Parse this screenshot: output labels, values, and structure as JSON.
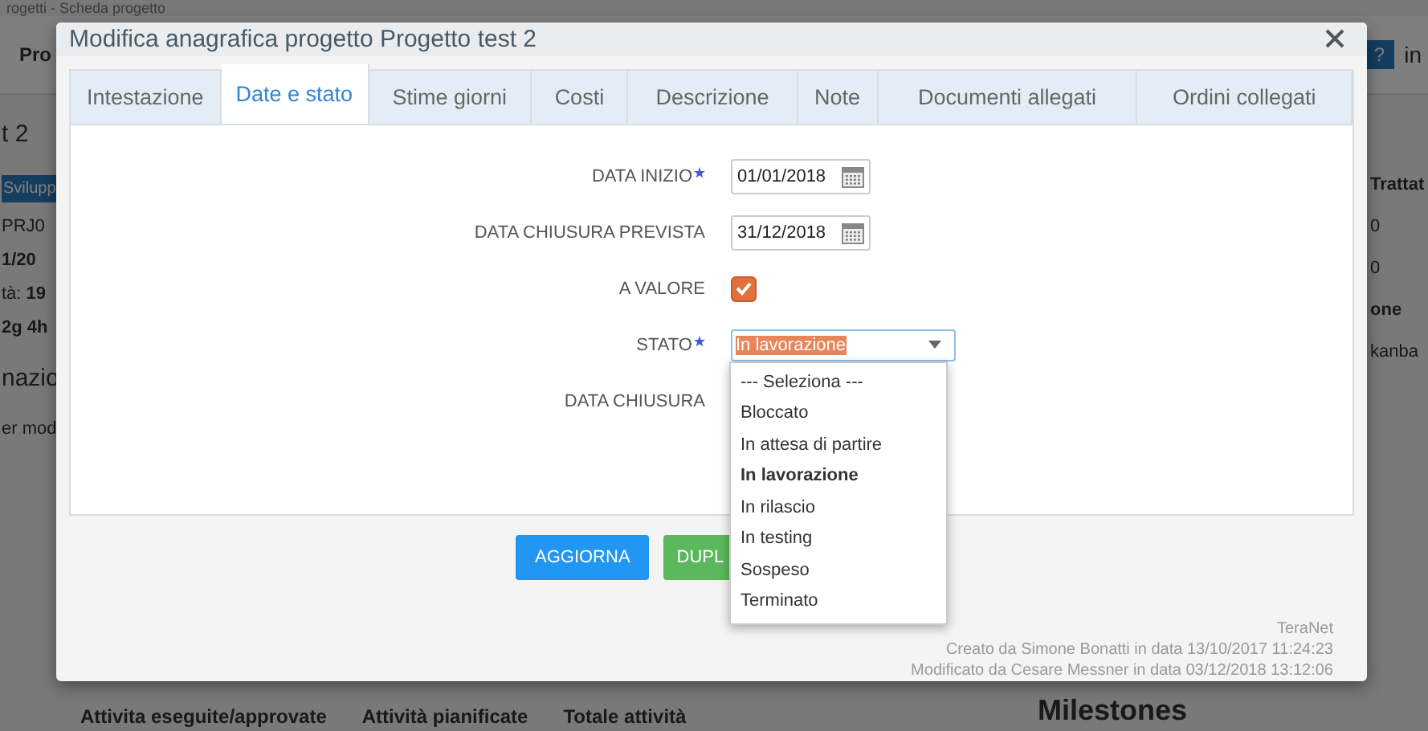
{
  "background": {
    "breadcrumb": "rogetti - Scheda progetto",
    "header_title": "Pro",
    "help": "?",
    "user": "in",
    "left": [
      {
        "kind": "title",
        "text": "t 2"
      },
      {
        "kind": "badge",
        "text": "Svilupp"
      },
      {
        "kind": "text",
        "text": "PRJ0"
      },
      {
        "kind": "bold",
        "text": "1/20"
      },
      {
        "kind": "mixed",
        "text": "tà: **19**"
      },
      {
        "kind": "bold",
        "text": "2g 4h"
      },
      {
        "kind": "title",
        "text": "nazio"
      },
      {
        "kind": "text",
        "text": "er mod"
      }
    ],
    "right": [
      {
        "kind": "bold",
        "text": "Trattat"
      },
      {
        "kind": "text",
        "text": "0"
      },
      {
        "kind": "text",
        "text": "0"
      },
      {
        "kind": "bold",
        "text": "one"
      },
      {
        "kind": "text",
        "text": "kanba"
      }
    ],
    "legend": [
      "Attivita eseguite/approvate",
      "Attività pianificate",
      "Totale attività"
    ],
    "panel_title": "Milestones"
  },
  "dialog": {
    "title": "Modifica anagrafica progetto Progetto test 2",
    "tabs": [
      {
        "label": "Intestazione",
        "selected": false
      },
      {
        "label": "Date e stato",
        "selected": true
      },
      {
        "label": "Stime giorni",
        "selected": false
      },
      {
        "label": "Costi",
        "selected": false
      },
      {
        "label": "Descrizione",
        "selected": false
      },
      {
        "label": "Note",
        "selected": false
      },
      {
        "label": "Documenti allegati",
        "selected": false
      },
      {
        "label": "Ordini collegati",
        "selected": false
      }
    ],
    "fields": [
      {
        "kind": "date",
        "label": "DATA INIZIO",
        "required": true,
        "value": "01/01/2018"
      },
      {
        "kind": "date",
        "label": "DATA CHIUSURA PREVISTA",
        "required": false,
        "value": "31/12/2018"
      },
      {
        "kind": "checkbox",
        "label": "A VALORE",
        "required": false,
        "checked": true
      },
      {
        "kind": "select",
        "label": "STATO",
        "required": true,
        "value": "In lavorazione",
        "highlighted": true,
        "expanded": true,
        "options": [
          {
            "label": "--- Seleziona ---",
            "selected": false
          },
          {
            "label": "Bloccato",
            "selected": false
          },
          {
            "label": "In attesa di partire",
            "selected": false
          },
          {
            "label": "In lavorazione",
            "selected": true
          },
          {
            "label": "In rilascio",
            "selected": false
          },
          {
            "label": "In testing",
            "selected": false
          },
          {
            "label": "Sospeso",
            "selected": false
          },
          {
            "label": "Terminato",
            "selected": false
          }
        ]
      },
      {
        "kind": "label",
        "label": "DATA CHIUSURA",
        "required": false
      }
    ],
    "buttons": [
      {
        "kind": "primary",
        "label": "AGGIORNA"
      },
      {
        "kind": "success",
        "label": "DUPL"
      }
    ],
    "footer": [
      "TeraNet",
      "Creato da Simone Bonatti in data 13/10/2017 11:24:23",
      "Modificato da Cesare Messner in data 03/12/2018 13:12:06"
    ]
  }
}
